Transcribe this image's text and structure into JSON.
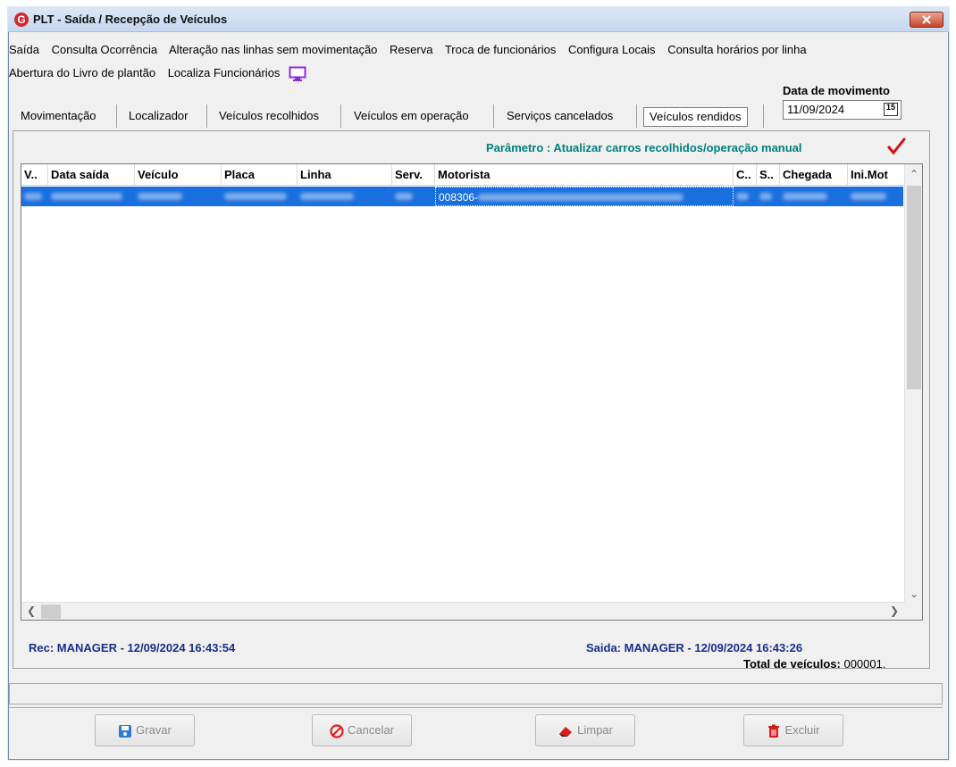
{
  "window": {
    "title": "PLT - Saída / Recepção de Veículos",
    "logo_letter": "G"
  },
  "menu": {
    "row1": [
      "Saída",
      "Consulta Ocorrência",
      "Alteração nas linhas sem movimentação",
      "Reserva",
      "Troca de funcionários",
      "Configura Locais",
      "Consulta horários por linha"
    ],
    "row2": [
      "Abertura do Livro de plantão",
      "Localiza Funcionários"
    ]
  },
  "tabs": [
    "Movimentação",
    "Localizador",
    "Veículos recolhidos",
    "Veículos em operação",
    "Serviços cancelados",
    "Veículos rendidos"
  ],
  "active_tab": "Veículos rendidos",
  "date": {
    "label": "Data de movimento",
    "value": "11/09/2024",
    "cal_icon_text": "15"
  },
  "parameter": "Parâmetro : Atualizar carros recolhidos/operação manual",
  "grid": {
    "columns": [
      "V..",
      "Data saída",
      "Veículo",
      "Placa",
      "Linha",
      "Serv.",
      "Motorista",
      "C..",
      "S..",
      "Chegada",
      "Ini.Mot"
    ],
    "rows": [
      {
        "motorista": "008306-"
      }
    ]
  },
  "status": {
    "rec": "Rec: MANAGER - 12/09/2024 16:43:54",
    "saida": "Saida: MANAGER - 12/09/2024 16:43:26",
    "total_label": "Total de veículos:",
    "total_value": "000001."
  },
  "buttons": {
    "gravar": "Gravar",
    "cancelar": "Cancelar",
    "limpar": "Limpar",
    "excluir": "Excluir"
  },
  "colors": {
    "selection": "#1a6fde",
    "param": "#008080",
    "status_text": "#1a2e8a"
  }
}
